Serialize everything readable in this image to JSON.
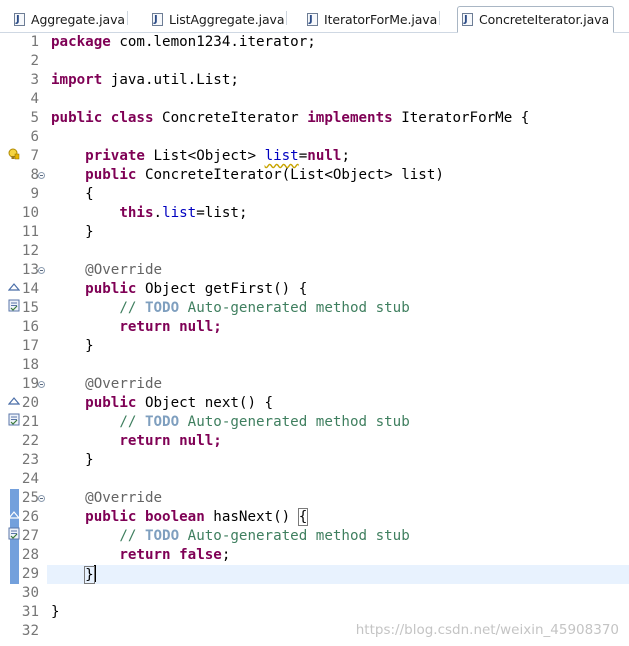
{
  "tabs": [
    {
      "label": "Aggregate.java",
      "icon": "java-file-icon",
      "active": false
    },
    {
      "label": "ListAggregate.java",
      "icon": "java-file-icon",
      "active": false
    },
    {
      "label": "IteratorForMe.java",
      "icon": "java-file-icon",
      "active": false
    },
    {
      "label": "ConcreteIterator.java",
      "icon": "java-file-icon",
      "active": true
    }
  ],
  "editor": {
    "line_numbers": [
      "1",
      "2",
      "3",
      "4",
      "5",
      "6",
      "7",
      "8",
      "9",
      "10",
      "11",
      "12",
      "13",
      "14",
      "15",
      "16",
      "17",
      "18",
      "19",
      "20",
      "21",
      "22",
      "23",
      "24",
      "25",
      "26",
      "27",
      "28",
      "29",
      "30",
      "31",
      "32"
    ],
    "current_line": 29,
    "colors": {
      "keyword": "#7f0055",
      "field": "#0000c0",
      "annotation": "#646464",
      "comment": "#3f7f5f",
      "todo": "#7f9fbf",
      "current_line_bg": "#e8f2fe"
    },
    "code": {
      "l1a": "package",
      "l1b": " com.lemon1234.iterator;",
      "l3a": "import",
      "l3b": " java.util.List;",
      "l5a": "public",
      "l5b": "class",
      "l5c": " ConcreteIterator ",
      "l5d": "implements",
      "l5e": " IteratorForMe {",
      "l7a": "private",
      "l7b": " List<Object> ",
      "l7c": "list",
      "l7d": "=",
      "l7e": "null",
      "l7f": ";",
      "l8a": "public",
      "l8b": " ConcreteIterator(List<Object> list)",
      "l9": "{",
      "l10a": "this",
      "l10b": ".",
      "l10c": "list",
      "l10d": "=list;",
      "l11": "}",
      "override": "@Override",
      "l14a": "public",
      "l14b": " Object getFirst() {",
      "todo_slash": "// ",
      "todo_word": "TODO",
      "todo_rest": " Auto-generated method stub",
      "ret": "return",
      "null_semicolon": " null;",
      "close": "}",
      "l20a": "public",
      "l20b": " Object next() {",
      "l26a": "public",
      "l26b": "boolean",
      "l26c": " hasNext() ",
      "l26d": "{",
      "l28a": "return",
      "l28b": "false",
      "l28c": ";",
      "l29": "}",
      "l31": "}"
    }
  },
  "gutter_icons": {
    "line7": "warning-lightbulb-icon",
    "line14": "override-triangle-icon",
    "line15": "task-todo-icon",
    "line20": "override-triangle-icon",
    "line21": "task-todo-icon",
    "line26": "override-triangle-icon",
    "line27": "task-todo-icon"
  },
  "watermark": "https://blog.csdn.net/weixin_45908370"
}
